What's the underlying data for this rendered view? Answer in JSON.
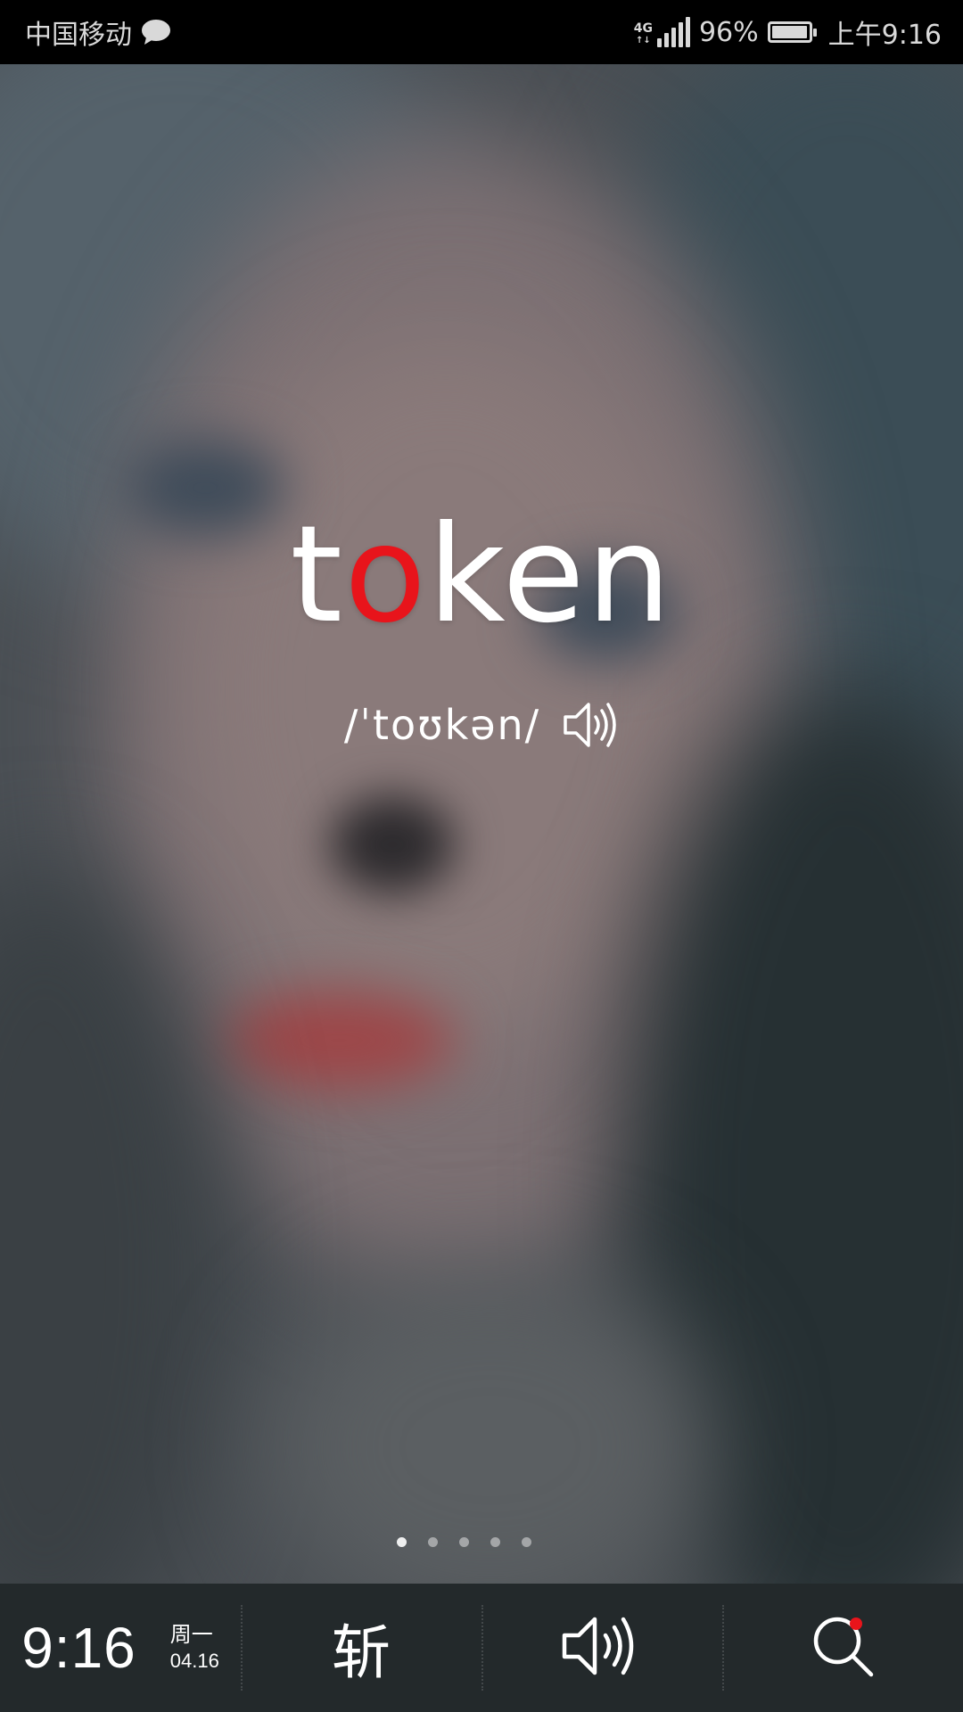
{
  "status_bar": {
    "carrier": "中国移动",
    "network": "4G",
    "battery_percent_label": "96%",
    "battery_level": 0.96,
    "time": "上午9:16"
  },
  "word": {
    "before": "t",
    "highlight": "o",
    "after": "ken",
    "phonetic": "/ˈtoʊkən/",
    "highlight_color": "#e8141b"
  },
  "pager": {
    "page_count": 5,
    "active_index": 0
  },
  "bottom_bar": {
    "time": "9:16",
    "weekday": "周一",
    "date": "04.16",
    "zhan_label": "斩",
    "icons": [
      "speaker-icon",
      "search-icon"
    ]
  }
}
